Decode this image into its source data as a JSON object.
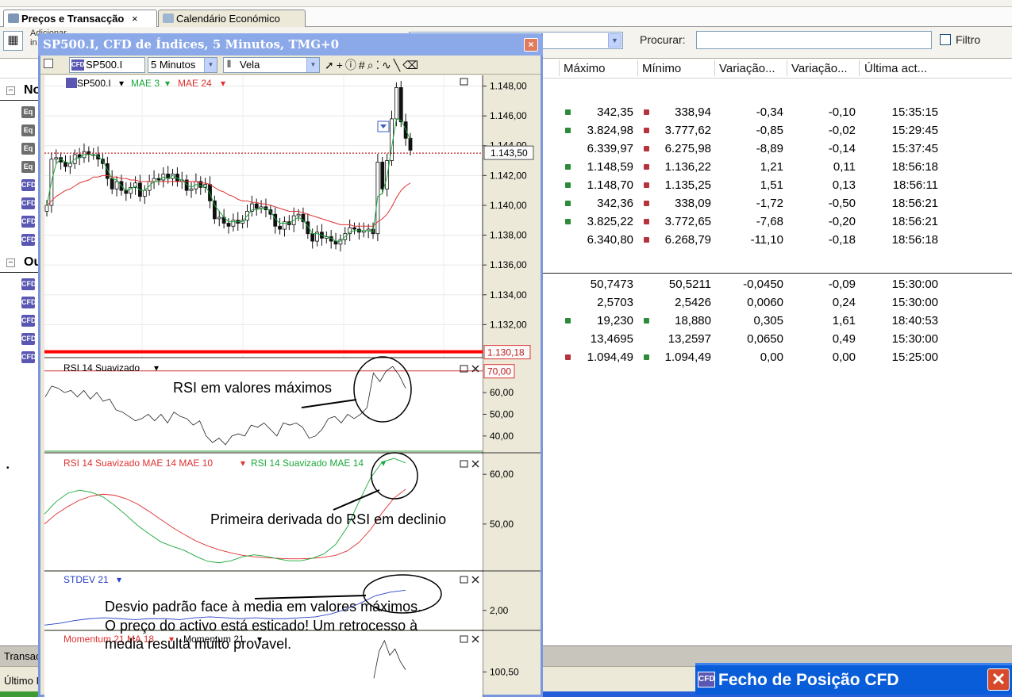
{
  "tabs": [
    {
      "label": "Preços e Transacção",
      "close": "×",
      "active": true
    },
    {
      "label": "Calendário Económico",
      "active": false
    }
  ],
  "toolbar": {
    "adicionar_line1": "Adicionar",
    "adicionar_line2": "in",
    "search_label": "Procurar:",
    "search_value": "",
    "filter_label": "Filtro"
  },
  "grid": {
    "columns": [
      "Máximo",
      "Mínimo",
      "Variação...",
      "Variação...",
      "Última act..."
    ],
    "groups": [
      {
        "label": "No",
        "toggle": "−"
      },
      {
        "label": "Ou",
        "toggle": "−"
      }
    ],
    "rows": [
      {
        "icon": "Eq",
        "max": "342,35",
        "max_dir": "up",
        "min": "338,94",
        "min_dir": "dn",
        "var1": "-0,34",
        "var2": "-0,10",
        "time": "15:35:15"
      },
      {
        "icon": "Eq",
        "max": "3.824,98",
        "max_dir": "up",
        "min": "3.777,62",
        "min_dir": "dn",
        "var1": "-0,85",
        "var2": "-0,02",
        "time": "15:29:45"
      },
      {
        "icon": "Eq",
        "max": "6.339,97",
        "max_dir": "",
        "min": "6.275,98",
        "min_dir": "dn",
        "var1": "-8,89",
        "var2": "-0,14",
        "time": "15:37:45"
      },
      {
        "icon": "Eq",
        "max": "1.148,59",
        "max_dir": "up",
        "min": "1.136,22",
        "min_dir": "dn",
        "var1": "1,21",
        "var2": "0,11",
        "time": "18:56:18"
      },
      {
        "icon": "CFD",
        "max": "1.148,70",
        "max_dir": "up",
        "min": "1.135,25",
        "min_dir": "dn",
        "var1": "1,51",
        "var2": "0,13",
        "time": "18:56:11"
      },
      {
        "icon": "CFD",
        "max": "342,36",
        "max_dir": "up",
        "min": "338,09",
        "min_dir": "dn",
        "var1": "-1,72",
        "var2": "-0,50",
        "time": "18:56:21"
      },
      {
        "icon": "CFD",
        "max": "3.825,22",
        "max_dir": "up",
        "min": "3.772,65",
        "min_dir": "dn",
        "var1": "-7,68",
        "var2": "-0,20",
        "time": "18:56:21"
      },
      {
        "icon": "CFD",
        "max": "6.340,80",
        "max_dir": "",
        "min": "6.268,79",
        "min_dir": "dn",
        "var1": "-11,10",
        "var2": "-0,18",
        "time": "18:56:18"
      },
      {
        "icon": "CFD",
        "max": "50,7473",
        "max_dir": "",
        "min": "50,5211",
        "min_dir": "",
        "var1": "-0,0450",
        "var2": "-0,09",
        "time": "15:30:00"
      },
      {
        "icon": "CFD",
        "max": "2,5703",
        "max_dir": "",
        "min": "2,5426",
        "min_dir": "",
        "var1": "0,0060",
        "var2": "0,24",
        "time": "15:30:00"
      },
      {
        "icon": "CFD",
        "max": "19,230",
        "max_dir": "up",
        "min": "18,880",
        "min_dir": "up",
        "var1": "0,305",
        "var2": "1,61",
        "time": "18:40:53"
      },
      {
        "icon": "CFD",
        "max": "13,4695",
        "max_dir": "",
        "min": "13,2597",
        "min_dir": "",
        "var1": "0,0650",
        "var2": "0,49",
        "time": "15:30:00"
      },
      {
        "icon": "CFD",
        "max": "1.094,49",
        "max_dir": "dn",
        "min": "1.094,49",
        "min_dir": "up",
        "var1": "0,00",
        "var2": "0,00",
        "time": "15:25:00"
      }
    ]
  },
  "bottom": {
    "tab_label": "Transacç",
    "status_label": "Último I"
  },
  "fecho": {
    "title": "Fecho de Posição CFD",
    "icon_label": "CFD",
    "close": "✕"
  },
  "chart_window": {
    "title": "SP500.I, CFD de Índices, 5 Minutos, TMG+0",
    "close": "×",
    "symbol": "SP500.I",
    "interval": "5 Minutos",
    "chart_type": "Vela"
  },
  "colors": {
    "up_arrow": "#2c8a38",
    "down_arrow": "#b5333c",
    "mae3": "#1aa83a",
    "mae24": "#e03030",
    "rsi_line": "#222222",
    "stdev_line": "#2a40c8"
  },
  "chart_data": [
    {
      "type": "candlestick",
      "legend": [
        "SP500.I",
        "MAE 3",
        "MAE 24"
      ],
      "ylim": [
        1130.0,
        1148.4
      ],
      "y_ticks": [
        "1.148,00",
        "1.146,00",
        "1.144,00",
        "1.142,00",
        "1.140,00",
        "1.138,00",
        "1.136,00",
        "1.134,00",
        "1.132,00"
      ],
      "current_price_label": "1.143,50",
      "current_price": 1143.5,
      "horizontal_line_label": "1.130,18",
      "horizontal_line": 1130.18,
      "close_series": [
        1140.0,
        1143.1,
        1143.2,
        1142.9,
        1142.6,
        1142.8,
        1143.4,
        1143.2,
        1143.6,
        1143.4,
        1143.4,
        1143.1,
        1142.8,
        1141.8,
        1141.1,
        1141.6,
        1141.0,
        1140.8,
        1141.2,
        1141.5,
        1140.6,
        1141.0,
        1141.6,
        1141.8,
        1141.7,
        1142.1,
        1141.8,
        1142.1,
        1141.6,
        1141.7,
        1141.0,
        1141.1,
        1141.6,
        1141.2,
        1141.4,
        1140.3,
        1139.1,
        1139.2,
        1138.8,
        1138.6,
        1139.0,
        1138.8,
        1139.0,
        1139.6,
        1140.1,
        1139.8,
        1139.9,
        1139.7,
        1139.4,
        1138.6,
        1138.4,
        1138.9,
        1138.7,
        1139.3,
        1139.4,
        1138.9,
        1138.1,
        1137.6,
        1138.2,
        1137.8,
        1137.9,
        1137.6,
        1137.4,
        1137.7,
        1138.1,
        1138.5,
        1138.4,
        1138.2,
        1138.3,
        1138.4,
        1138.1,
        1142.9,
        1141.1,
        1143.0,
        1145.8,
        1147.9,
        1145.6,
        1144.5,
        1143.7
      ],
      "mae3": [
        1140.0,
        1141.6,
        1142.8,
        1143.1,
        1142.9,
        1142.8,
        1143.1,
        1143.2,
        1143.4,
        1143.4,
        1143.4,
        1143.3,
        1143.0,
        1142.4,
        1141.8,
        1141.7,
        1141.3,
        1141.0,
        1141.1,
        1141.3,
        1141.0,
        1141.0,
        1141.3,
        1141.6,
        1141.6,
        1141.9,
        1141.8,
        1142.0,
        1141.8,
        1141.7,
        1141.4,
        1141.2,
        1141.4,
        1141.3,
        1141.3,
        1140.8,
        1140.0,
        1139.6,
        1139.2,
        1138.9,
        1138.9,
        1138.9,
        1138.9,
        1139.3,
        1139.7,
        1139.7,
        1139.8,
        1139.8,
        1139.6,
        1139.1,
        1138.8,
        1138.8,
        1138.8,
        1139.0,
        1139.2,
        1139.0,
        1138.6,
        1138.1,
        1138.1,
        1138.0,
        1137.9,
        1137.8,
        1137.6,
        1137.6,
        1137.9,
        1138.2,
        1138.3,
        1138.3,
        1138.3,
        1138.3,
        1138.2,
        1140.6,
        1140.8,
        1141.9,
        1143.9,
        1145.8,
        1145.7,
        1145.1,
        1144.4
      ],
      "mae24": [
        1140.0,
        1140.3,
        1140.6,
        1140.8,
        1141.0,
        1141.1,
        1141.3,
        1141.5,
        1141.6,
        1141.7,
        1141.9,
        1141.9,
        1142.0,
        1142.0,
        1141.9,
        1141.9,
        1141.8,
        1141.8,
        1141.7,
        1141.7,
        1141.6,
        1141.6,
        1141.6,
        1141.6,
        1141.6,
        1141.6,
        1141.6,
        1141.6,
        1141.6,
        1141.6,
        1141.6,
        1141.6,
        1141.6,
        1141.5,
        1141.5,
        1141.4,
        1141.2,
        1141.0,
        1140.9,
        1140.7,
        1140.6,
        1140.4,
        1140.3,
        1140.3,
        1140.2,
        1140.2,
        1140.1,
        1140.1,
        1140.0,
        1139.9,
        1139.8,
        1139.7,
        1139.6,
        1139.6,
        1139.6,
        1139.5,
        1139.4,
        1139.3,
        1139.2,
        1139.1,
        1139.0,
        1138.9,
        1138.8,
        1138.7,
        1138.7,
        1138.7,
        1138.6,
        1138.6,
        1138.6,
        1138.6,
        1138.6,
        1138.9,
        1139.1,
        1139.4,
        1139.9,
        1140.5,
        1141.0,
        1141.3,
        1141.5
      ]
    },
    {
      "type": "line",
      "legend": [
        "RSI 14 Suavizado"
      ],
      "ylim": [
        33,
        75
      ],
      "y_ticks": [
        "60,00",
        "50,00",
        "40,00"
      ],
      "level_label": "70,00",
      "level": 70,
      "values": [
        58,
        63,
        62,
        60,
        61,
        58,
        61,
        57,
        60,
        56,
        57,
        52,
        51,
        49,
        47,
        48,
        50,
        47,
        50,
        46,
        51,
        49,
        48,
        45,
        47,
        40,
        37,
        39,
        36,
        40,
        41,
        40,
        45,
        44,
        46,
        43,
        40,
        46,
        45,
        46,
        44,
        39,
        40,
        43,
        48,
        49,
        46,
        50,
        48,
        50,
        53,
        69,
        65,
        70,
        72,
        68,
        62
      ]
    },
    {
      "type": "line",
      "legend": [
        "RSI 14 Suavizado MAE 14 MAE 10",
        "RSI 14 Suavizado MAE 14"
      ],
      "ylim": [
        41.2,
        63.7
      ],
      "y_ticks": [
        "60,00",
        "50,00"
      ],
      "series": [
        {
          "name": "RSI 14 Suavizado MAE 14 MAE 10",
          "values": [
            50.0,
            52.0,
            53.5,
            54.8,
            55.6,
            56.0,
            55.8,
            55.1,
            54.0,
            52.5,
            50.9,
            49.3,
            47.9,
            46.6,
            45.6,
            44.8,
            44.2,
            43.7,
            43.4,
            43.2,
            43.1,
            43.0,
            43.0,
            43.1,
            43.3,
            43.7,
            44.6,
            46.3,
            48.9,
            52.3,
            55.2,
            57.0
          ]
        },
        {
          "name": "RSI 14 Suavizado MAE 14",
          "values": [
            52.0,
            54.5,
            56.2,
            56.8,
            56.4,
            55.5,
            53.8,
            51.8,
            49.7,
            48.0,
            46.4,
            45.5,
            44.7,
            43.5,
            42.5,
            42.2,
            42.6,
            43.4,
            43.8,
            43.5,
            43.0,
            42.6,
            42.6,
            43.1,
            44.0,
            45.9,
            49.4,
            54.5,
            59.3,
            62.5,
            63.2,
            62.3
          ]
        }
      ]
    },
    {
      "type": "line",
      "legend": [
        "STDEV 21"
      ],
      "y_ticks": [
        "2,00"
      ],
      "values": [
        0.4,
        0.6,
        0.9,
        1.1,
        1.2,
        1.1,
        1.0,
        1.1,
        1.1,
        1.0,
        1.2,
        1.3,
        1.2,
        1.1,
        1.2,
        1.1,
        1.1,
        1.2,
        1.3,
        1.6,
        2.1,
        2.8,
        3.6,
        4.0,
        4.2
      ]
    },
    {
      "type": "line",
      "legend": [
        "Momentum 21 MA 18",
        "Momentum 21"
      ],
      "y_ticks": [
        "100,50"
      ],
      "values": [
        100.35,
        101.0,
        101.25,
        100.9,
        101.05,
        100.75,
        100.55
      ]
    }
  ],
  "annotations": [
    "RSI em valores máximos",
    "Primeira derivada do RSI em declinio",
    "Desvio padrão face à media em valores máximos.",
    "O preço do activo está esticado! Um retrocesso à",
    "media resulta muito provavel."
  ],
  "dropdown_caret": "▾"
}
